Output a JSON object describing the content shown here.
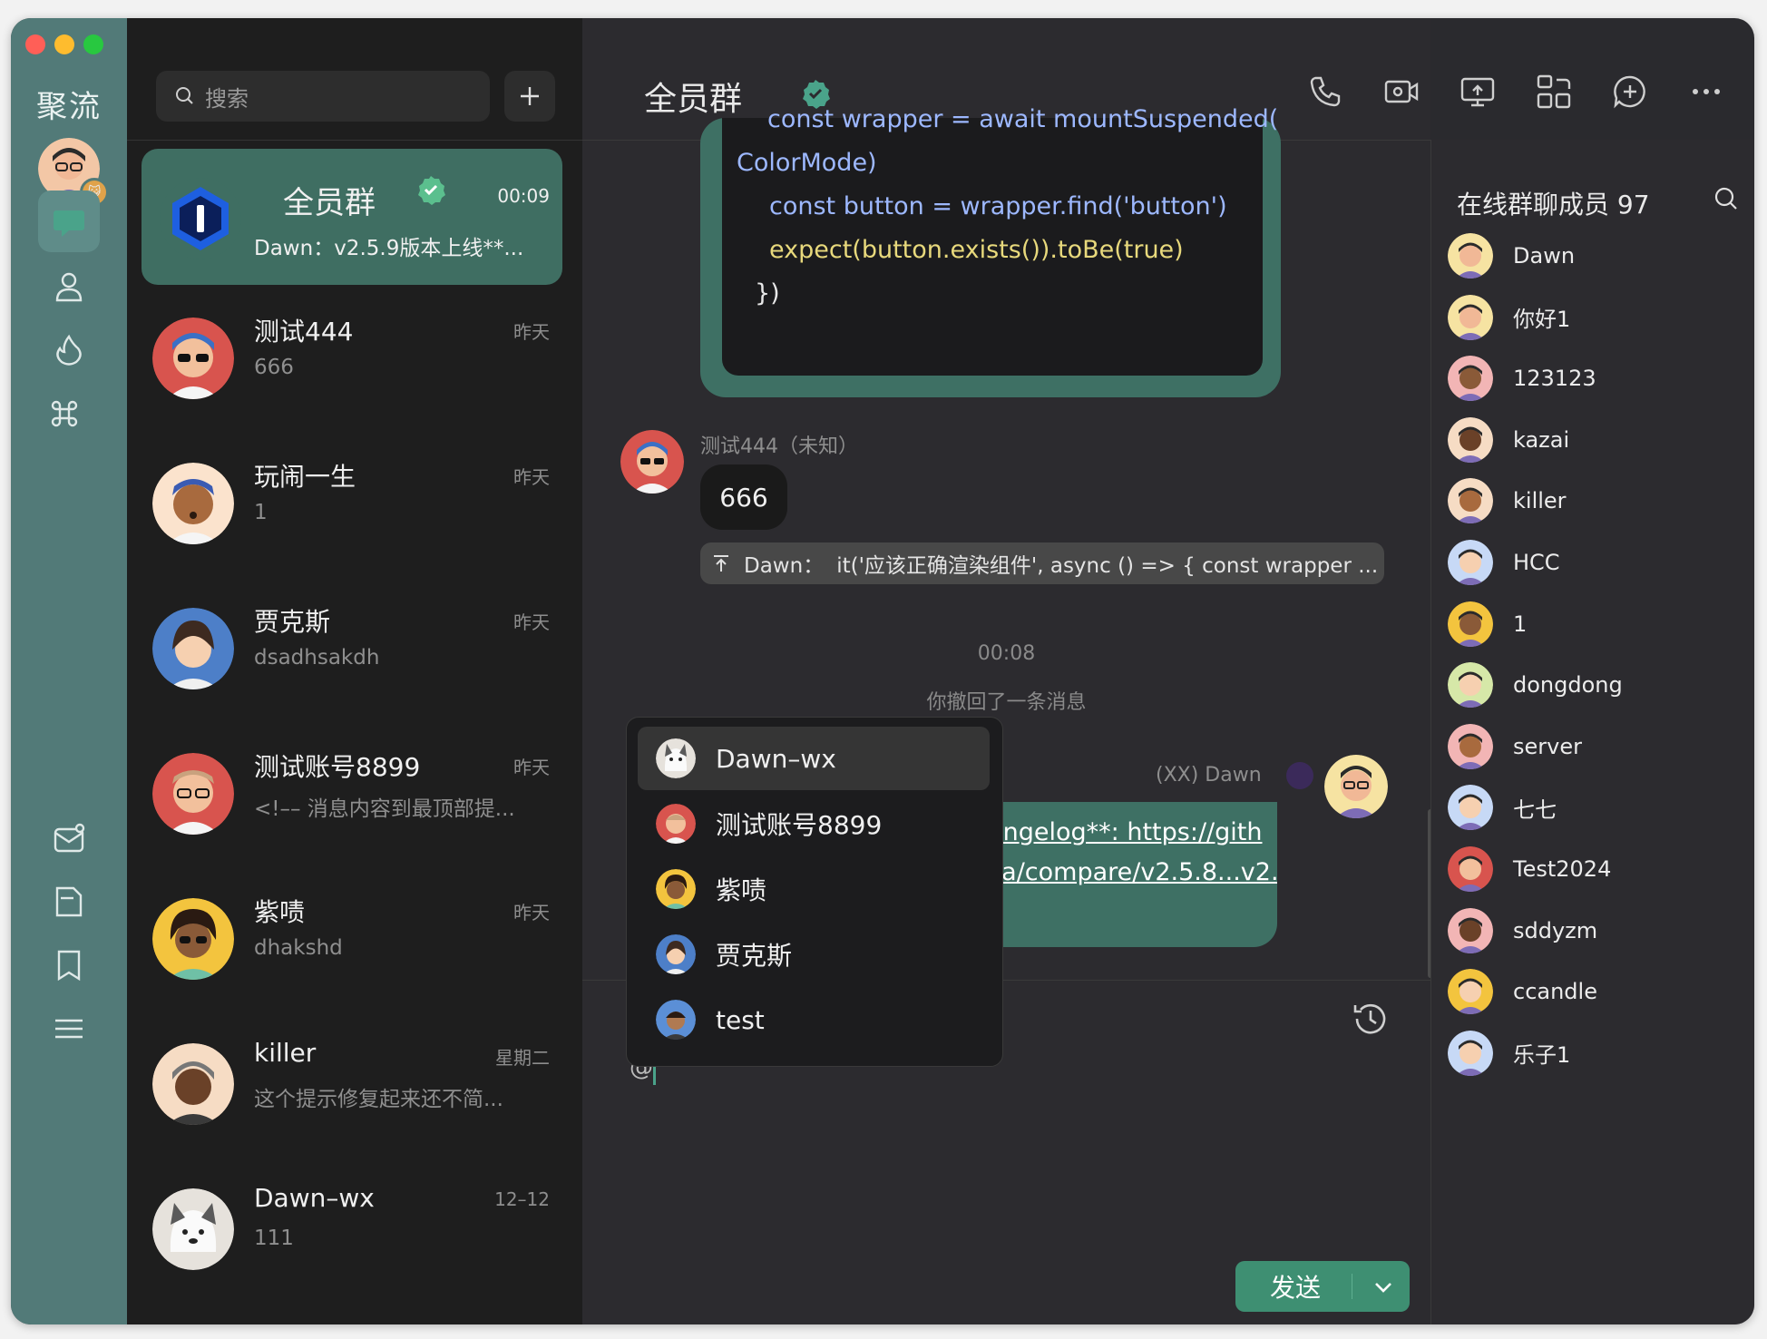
{
  "app": {
    "brand": "聚流"
  },
  "colors": {
    "accent": "#3e7064",
    "rail": "#527a78",
    "send": "#3e8f72"
  },
  "search": {
    "placeholder": "搜索"
  },
  "conversations": [
    {
      "name": "全员群",
      "time": "00:09",
      "preview": "Dawn：v2.5.9版本上线**...",
      "verified": true,
      "active": true
    },
    {
      "name": "测试444",
      "time": "昨天",
      "preview": "666"
    },
    {
      "name": "玩闹一生",
      "time": "昨天",
      "preview": "1"
    },
    {
      "name": "贾克斯",
      "time": "昨天",
      "preview": "dsadhsakdh"
    },
    {
      "name": "测试账号8899",
      "time": "昨天",
      "preview": "<!–– 消息内容到最顶部提..."
    },
    {
      "name": "紫啧",
      "time": "昨天",
      "preview": "dhakshd"
    },
    {
      "name": "killer",
      "time": "星期二",
      "preview": "这个提示修复起来还不简..."
    },
    {
      "name": "Dawn–wx",
      "time": "12–12",
      "preview": "111"
    }
  ],
  "chat": {
    "title": "全员群",
    "toolbar_icons": [
      "phone-icon",
      "video-icon",
      "screen-share-icon",
      "remote-control-icon",
      "add-chat-icon",
      "more-icon"
    ],
    "code_lines": [
      "const wrapper = await mountSuspended(",
      "ColorMode)",
      "const button = wrapper.find('button')",
      "expect(button.exists()).toBe(true)",
      "})"
    ],
    "msg_sender": "测试444（未知）",
    "msg_text": "666",
    "quote_user": "Dawn：",
    "quote_text": "it('应该正确渲染组件', async () => { const wrapper ...",
    "center_time": "00:08",
    "recall_notice": "你撤回了一条消息",
    "my_sender": "(XX) Dawn",
    "link_line1": "hangelog**: https://gith",
    "link_line2": "uLa/compare/v2.5.8...v2.",
    "input_value": "@",
    "send_label": "发送"
  },
  "mention_popup": [
    {
      "name": "Dawn–wx",
      "active": true
    },
    {
      "name": "测试账号8899"
    },
    {
      "name": "紫啧"
    },
    {
      "name": "贾克斯"
    },
    {
      "name": "test"
    }
  ],
  "members": {
    "title": "在线群聊成员 97",
    "list": [
      "Dawn",
      "你好1",
      "123123",
      "kazai",
      "killer",
      "HCC",
      "1",
      "dongdong",
      "server",
      "七七",
      "Test2024",
      "sddyzm",
      "ccandle",
      "乐子1"
    ]
  }
}
